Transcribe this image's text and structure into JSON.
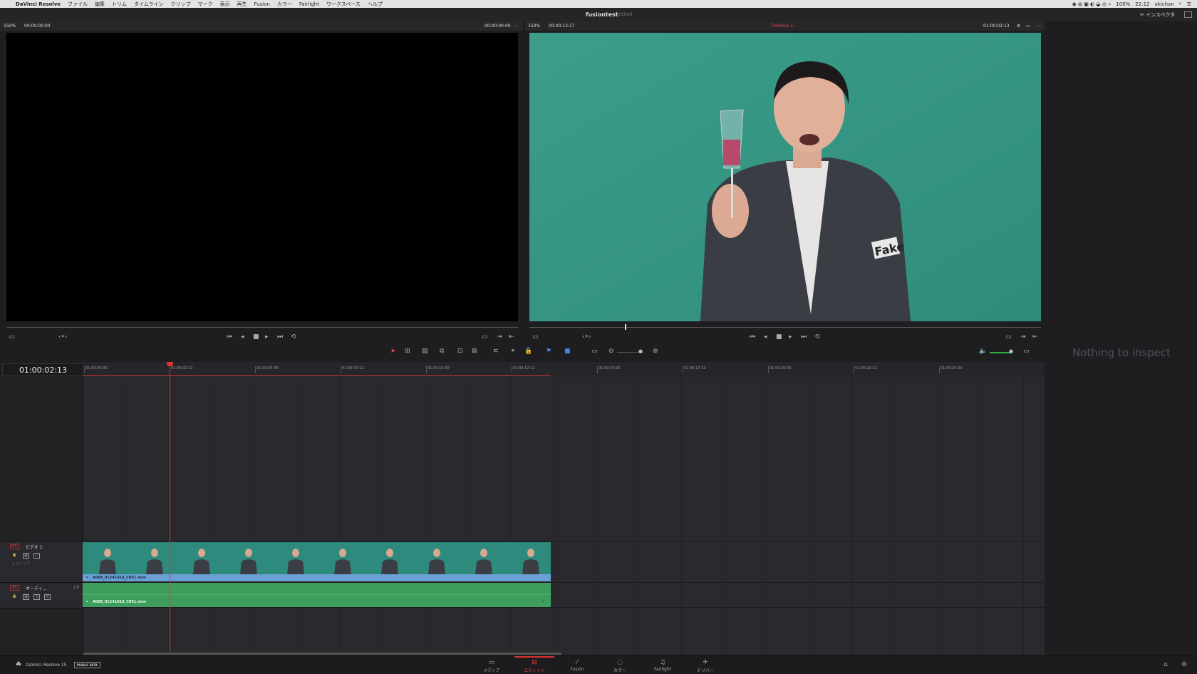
{
  "menubar": {
    "app": "DaVinci Resolve",
    "items": [
      "ファイル",
      "編集",
      "トリム",
      "タイムライン",
      "クリップ",
      "マーク",
      "表示",
      "再生",
      "Fusion",
      "カラー",
      "Fairlight",
      "ワークスペース",
      "ヘルプ"
    ],
    "battery": "100%",
    "clock": "22:12",
    "user": "akichan"
  },
  "title": {
    "project": "fusiontest",
    "status": "Edited",
    "inspector_label": "インスペクタ"
  },
  "source_viewer": {
    "zoom": "150%",
    "timecode_left": "00:00:00:00",
    "timecode_right": "00:00:00:00"
  },
  "timeline_viewer": {
    "zoom": "150%",
    "duration": "00:00:13:17",
    "timeline_name": "Timeline 1",
    "timecode": "01:00:02:13",
    "progress": 0.187
  },
  "timeline": {
    "current_timecode": "01:00:02:13",
    "ruler": [
      "01:00:00:00",
      "01:00:02:12",
      "01:00:05:00",
      "01:00:07:12",
      "01:00:10:00",
      "01:00:12:12",
      "01:00:15:00",
      "01:00:17:12",
      "01:00:20:00",
      "01:00:22:12",
      "01:00:25:00"
    ],
    "video_track": {
      "tag": "V1",
      "name": "ビデオ 1",
      "clip_count": "1 クリップ",
      "clip_name": "A008_01241818_C051.mov"
    },
    "audio_track": {
      "tag": "A1",
      "name": "オーディ...",
      "level": "2.0",
      "clip_name": "A008_01241818_C051.mov",
      "solo": "S",
      "mute": "M"
    }
  },
  "inspector": {
    "empty_message": "Nothing to inspect"
  },
  "bottombar": {
    "brand": "DaVinci Resolve 15",
    "badge": "PUBLIC BETA",
    "pages": [
      {
        "label": "メディア",
        "icon": "▭"
      },
      {
        "label": "エディット",
        "icon": "⊟"
      },
      {
        "label": "Fusion",
        "icon": "⁄"
      },
      {
        "label": "カラー",
        "icon": "◌"
      },
      {
        "label": "Fairlight",
        "icon": "♫"
      },
      {
        "label": "デリバー",
        "icon": "✈"
      }
    ],
    "active_page": 1
  },
  "colors": {
    "accent_red": "#dd3333",
    "video_clip": "#2d8a7d",
    "audio_clip": "#3f9e5d",
    "clip_label": "#6aa0d6"
  }
}
